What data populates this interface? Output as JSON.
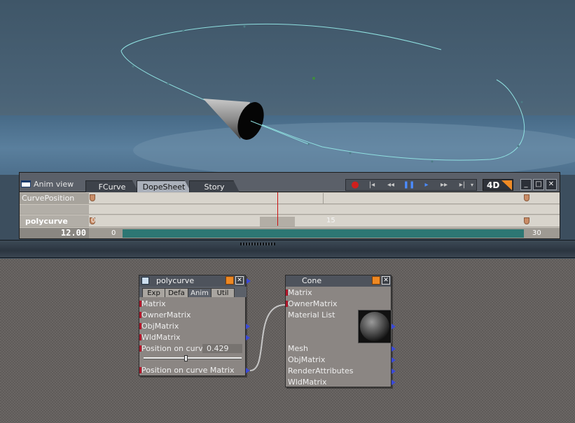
{
  "animview": {
    "title": "Anim view",
    "tabs": [
      "FCurve",
      "DopeSheet",
      "Story"
    ],
    "active_tab": "DopeSheet",
    "mode_label": "4D",
    "track_curve": "CurvePosition",
    "track_object": "polycurve",
    "ruler_start": "0",
    "ruler_mid": "15",
    "current_frame": "12.00",
    "frame_start": "0",
    "frame_end": "30"
  },
  "nodes": {
    "polycurve": {
      "title": "polycurve",
      "tabs": [
        "Exp",
        "Defa",
        "Anim",
        "Util"
      ],
      "active_tab": "Anim",
      "ports": [
        "Matrix",
        "OwnerMatrix",
        "ObjMatrix",
        "WldMatrix"
      ],
      "param_label": "Position on curve",
      "param_value": "0.429",
      "param_fraction": 0.429,
      "out_port": "Position on curve Matrix"
    },
    "cone": {
      "title": "Cone",
      "ports_top": [
        "Matrix",
        "OwnerMatrix",
        "Material List"
      ],
      "ports_bottom": [
        "Mesh",
        "ObjMatrix",
        "RenderAttributes",
        "WldMatrix"
      ]
    }
  },
  "colors": {
    "curve": "#8fe0e0",
    "accent": "#ee8822",
    "timeline_bar": "#2d7774",
    "cursor": "#cc1111"
  }
}
